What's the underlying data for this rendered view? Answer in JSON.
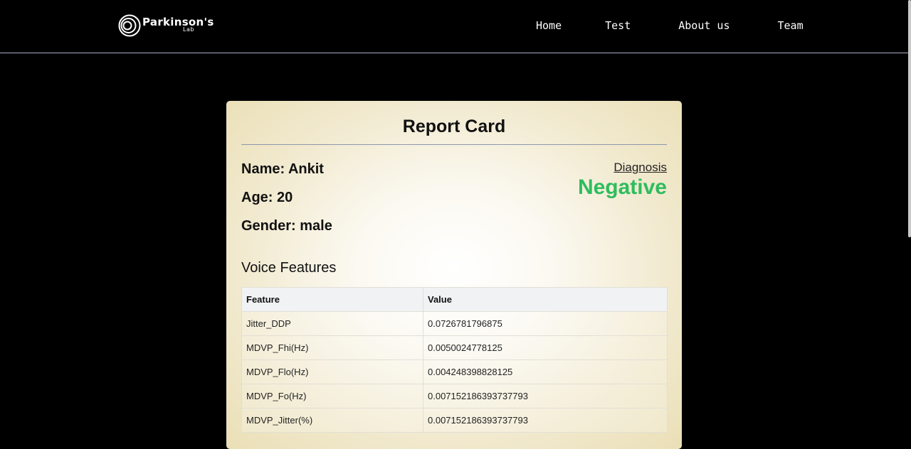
{
  "nav": {
    "logo_title": "Parkinson's",
    "logo_sub": "Lab",
    "links": [
      "Home",
      "Test",
      "About us",
      "Team"
    ]
  },
  "report": {
    "title": "Report Card",
    "name": "Name: Ankit",
    "age": "Age: 20",
    "gender": "Gender: male",
    "diagnosis_label": "Diagnosis",
    "diagnosis_value": "Negative",
    "diagnosis_color": "#2ebd5e"
  },
  "features": {
    "section_title": "Voice Features",
    "headers": [
      "Feature",
      "Value"
    ],
    "rows": [
      {
        "feature": "Jitter_DDP",
        "value": "0.0726781796875"
      },
      {
        "feature": "MDVP_Fhi(Hz)",
        "value": "0.0050024778125"
      },
      {
        "feature": "MDVP_Flo(Hz)",
        "value": "0.004248398828125"
      },
      {
        "feature": "MDVP_Fo(Hz)",
        "value": "0.007152186393737793"
      },
      {
        "feature": "MDVP_Jitter(%)",
        "value": "0.007152186393737793"
      }
    ]
  },
  "icons": {
    "logo": "concentric-circles-logo-icon"
  }
}
